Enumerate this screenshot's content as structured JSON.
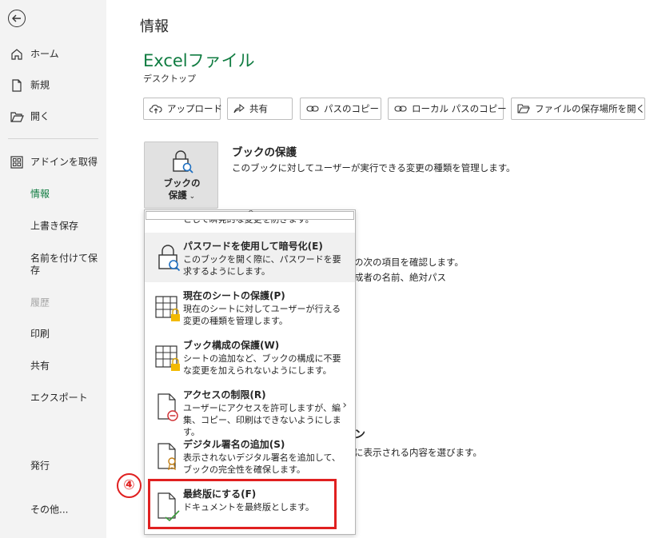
{
  "sidebar": {
    "back_label": "",
    "items": [
      {
        "label": "ホーム",
        "icon": "home-icon"
      },
      {
        "label": "新規",
        "icon": "new-file-icon"
      },
      {
        "label": "開く",
        "icon": "folder-open-icon"
      },
      {
        "label": "アドインを取得",
        "icon": "addins-grid-icon"
      },
      {
        "label": "情報",
        "state": "active"
      },
      {
        "label": "上書き保存"
      },
      {
        "label": "名前を付けて保存"
      },
      {
        "label": "履歴",
        "state": "disabled"
      },
      {
        "label": "印刷"
      },
      {
        "label": "共有"
      },
      {
        "label": "エクスポート"
      },
      {
        "label": "発行"
      },
      {
        "label": "その他..."
      }
    ]
  },
  "main": {
    "page_title": "情報",
    "file_title": "Excelファイル",
    "file_location": "デスクトップ",
    "toolbar": {
      "upload": "アップロード",
      "share": "共有",
      "copy_path": "パスのコピー",
      "copy_local_path": "ローカル パスのコピー",
      "open_location": "ファイルの保存場所を開く"
    },
    "protect": {
      "button_line1": "ブックの",
      "button_line2": "保護",
      "title": "ブックの保護",
      "description": "このブックに対してユーザーが実行できる変更の種類を管理します。"
    },
    "behind_text": {
      "line1": "の次の項目を確認します。",
      "line2": "成者の名前、絶対パス",
      "line3": "ン",
      "line4": "に表示される内容を選びます。"
    }
  },
  "dropdown": {
    "cut_text": "として瞬発的な変更を防ぎます。",
    "items": [
      {
        "title": "パスワードを使用して暗号化(E)",
        "desc": "このブックを開く際に、パスワードを要求するようにします。"
      },
      {
        "title": "現在のシートの保護(P)",
        "desc": "現在のシートに対してユーザーが行える変更の種類を管理します。"
      },
      {
        "title": "ブック構成の保護(W)",
        "desc": "シートの追加など、ブックの構成に不要な変更を加えられないようにします。"
      },
      {
        "title": "アクセスの制限(R)",
        "desc": "ユーザーにアクセスを許可しますが、編集、コピー、印刷はできないようにします。",
        "submenu": "›"
      },
      {
        "title": "デジタル署名の追加(S)",
        "desc": "表示されないデジタル署名を追加して、ブックの完全性を確保します。"
      },
      {
        "title": "最終版にする(F)",
        "desc": "ドキュメントを最終版とします。"
      }
    ]
  },
  "annotation": {
    "step": "④",
    "color": "#e02020"
  },
  "colors": {
    "accent": "#107c41",
    "sidebar_bg": "#f3f3f3"
  }
}
